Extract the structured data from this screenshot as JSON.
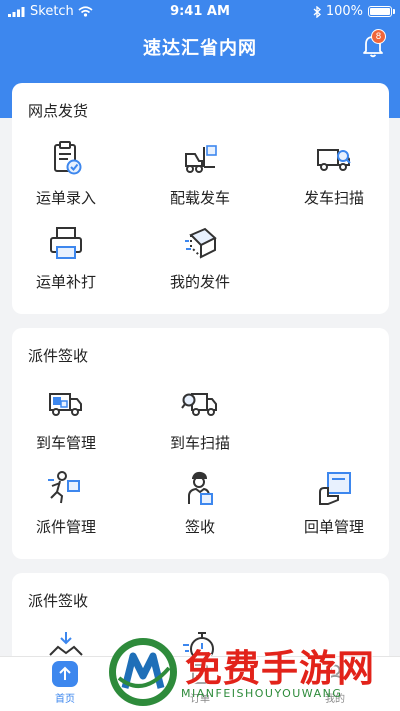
{
  "status_bar": {
    "carrier": "Sketch",
    "time": "9:41 AM",
    "battery": "100%"
  },
  "header": {
    "title": "速达汇省内网",
    "notification_count": "8"
  },
  "sections": [
    {
      "title": "网点发货",
      "items": [
        {
          "label": "运单录入",
          "icon": "clipboard-check-icon"
        },
        {
          "label": "配载发车",
          "icon": "forklift-icon"
        },
        {
          "label": "发车扫描",
          "icon": "truck-scan-icon"
        },
        {
          "label": "运单补打",
          "icon": "printer-icon"
        },
        {
          "label": "我的发件",
          "icon": "package-icon"
        }
      ]
    },
    {
      "title": "派件签收",
      "items": [
        {
          "label": "到车管理",
          "icon": "truck-boxes-icon"
        },
        {
          "label": "到车扫描",
          "icon": "truck-magnifier-icon"
        },
        {
          "label": "派件管理",
          "icon": "courier-running-icon"
        },
        {
          "label": "签收",
          "icon": "courier-sign-icon"
        },
        {
          "label": "回单管理",
          "icon": "receipt-hand-icon"
        }
      ]
    },
    {
      "title": "派件签收",
      "items": [
        {
          "label": "",
          "icon": "unload-icon"
        },
        {
          "label": "",
          "icon": "stopwatch-icon"
        }
      ]
    }
  ],
  "tabbar": [
    {
      "label": "首页",
      "icon": "home-icon",
      "active": true
    },
    {
      "label": "订单",
      "icon": "order-icon",
      "active": false
    },
    {
      "label": "我的",
      "icon": "profile-icon",
      "active": false
    }
  ],
  "watermark": {
    "text": "免费手游网",
    "subtext": "MIANFEISHOUYOUWANG"
  },
  "colors": {
    "primary": "#3d87ee",
    "background": "#f2f3f5",
    "badge": "#f0663a"
  }
}
